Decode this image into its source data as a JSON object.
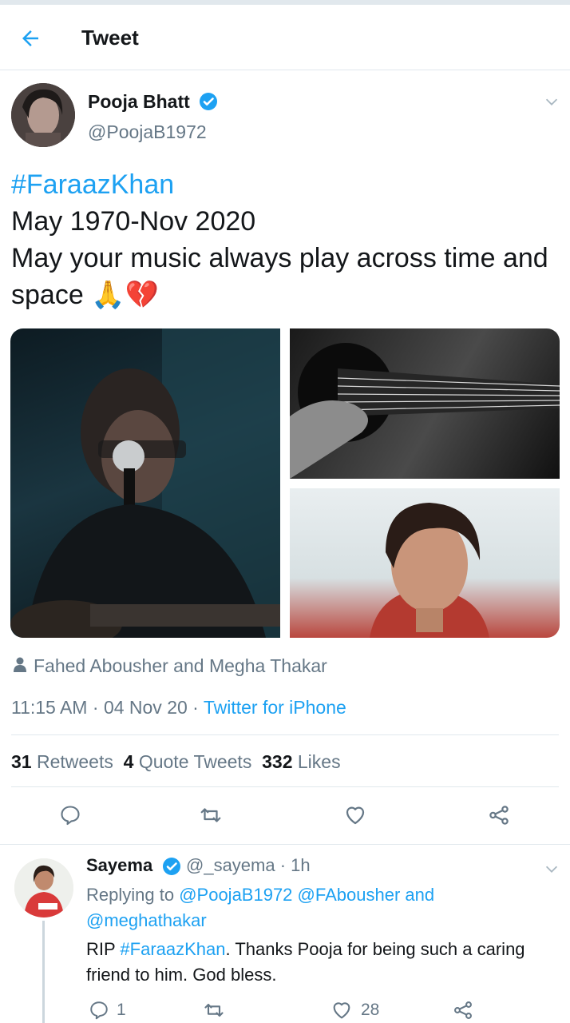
{
  "header": {
    "title": "Tweet"
  },
  "tweet": {
    "author_name": "Pooja Bhatt",
    "author_handle": "@PoojaB1972",
    "hashtag": "#FaraazKhan",
    "line2": "May 1970-Nov 2020",
    "line3": "May your music always play across time and space",
    "emojis": "🙏💔",
    "tagged": "Fahed Abousher and Megha Thakar",
    "time": "11:15 AM",
    "date": "04 Nov 20",
    "source": "Twitter for iPhone",
    "stats": {
      "retweets_count": "31",
      "retweets_label": "Retweets",
      "quotes_count": "4",
      "quotes_label": "Quote Tweets",
      "likes_count": "332",
      "likes_label": "Likes"
    }
  },
  "reply": {
    "name": "Sayema",
    "handle_time": "@_sayema · 1h",
    "replying_prefix": "Replying to",
    "replying_to": "@PoojaB1972 @FAbousher and @meghathakar",
    "text_prefix": "RIP",
    "hashtag": "#FaraazKhan",
    "text_rest": ". Thanks Pooja for being such a caring friend to him. God bless.",
    "reply_count": "1",
    "like_count": "28"
  },
  "colors": {
    "accent": "#1da1f2",
    "secondary_text": "#657786",
    "divider": "#e1e8ed"
  },
  "icons": [
    "back-arrow-icon",
    "verified-badge-icon",
    "chevron-down-icon",
    "person-icon",
    "reply-icon",
    "retweet-icon",
    "heart-icon",
    "share-icon"
  ]
}
